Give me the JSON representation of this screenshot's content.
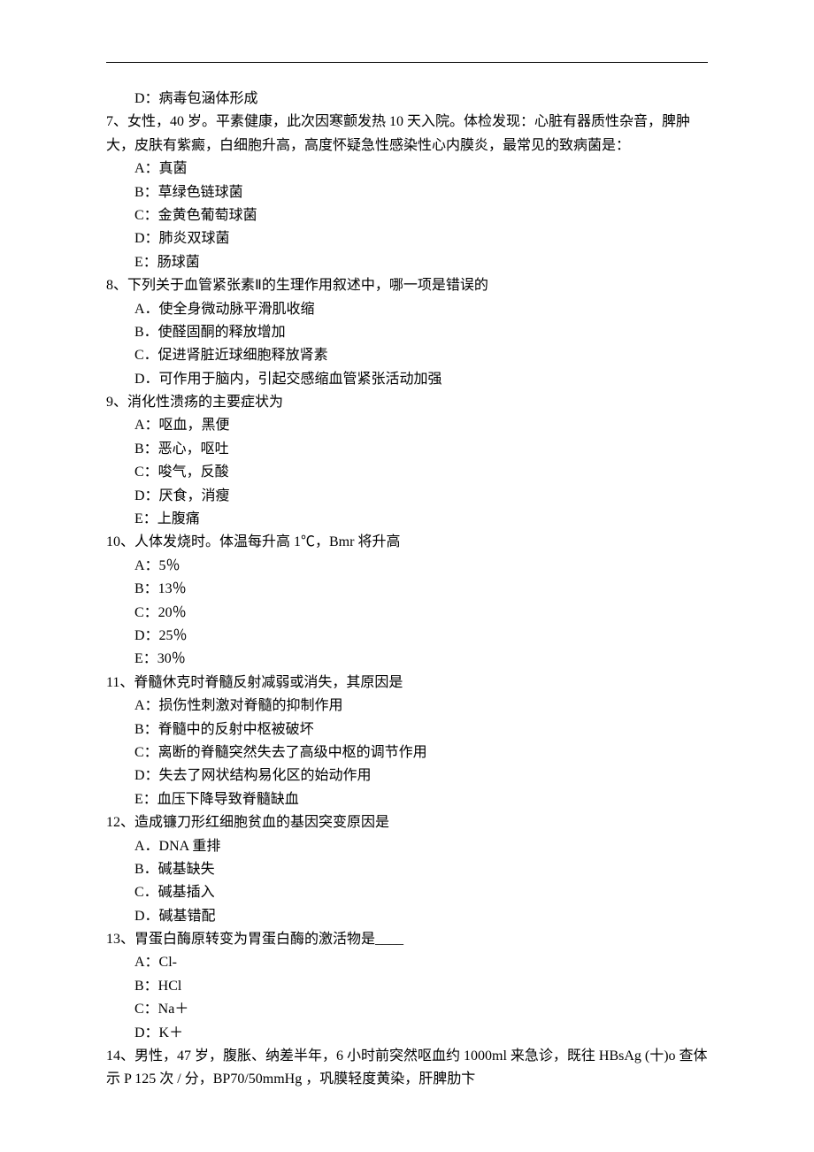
{
  "fragments": {
    "q6d": "　D：病毒包涵体形成"
  },
  "questions": {
    "q7": {
      "text": "7、女性，40 岁。平素健康，此次因寒颤发热 10 天入院。体检发现：心脏有器质性杂音，脾肿大，皮肤有紫癜，白细胞升高，高度怀疑急性感染性心内膜炎，最常见的致病菌是：",
      "options": {
        "a": "　A：真菌",
        "b": "　B：草绿色链球菌",
        "c": "　C：金黄色葡萄球菌",
        "d": "　D：肺炎双球菌",
        "e": "　E：肠球菌"
      }
    },
    "q8": {
      "text": "8、下列关于血管紧张素Ⅱ的生理作用叙述中，哪一项是错误的",
      "options": {
        "a": "　A．使全身微动脉平滑肌收缩",
        "b": "　B．使醛固酮的释放增加",
        "c": "　C．促进肾脏近球细胞释放肾素",
        "d": "　D．可作用于脑内，引起交感缩血管紧张活动加强"
      }
    },
    "q9": {
      "text": "9、消化性溃疡的主要症状为",
      "options": {
        "a": "　A：呕血，黑便",
        "b": "　B：恶心，呕吐",
        "c": "　C：唆气，反酸",
        "d": "　D：厌食，消瘦",
        "e": "　E：上腹痛"
      }
    },
    "q10": {
      "text": "10、人体发烧时。体温每升高 1℃，Bmr 将升高",
      "options": {
        "a": "　A：5％",
        "b": "　B：13％",
        "c": "　C：20％",
        "d": "　D：25％",
        "e": "　E：30％"
      }
    },
    "q11": {
      "text": "11、脊髓休克时脊髓反射减弱或消失，其原因是",
      "options": {
        "a": "　A：损伤性刺激对脊髓的抑制作用",
        "b": "　B：脊髓中的反射中枢被破坏",
        "c": "　C：离断的脊髓突然失去了高级中枢的调节作用",
        "d": "　D：失去了网状结构易化区的始动作用",
        "e": "　E：血压下降导致脊髓缺血"
      }
    },
    "q12": {
      "text": "12、造成镰刀形红细胞贫血的基因突变原因是",
      "options": {
        "a": "　A．DNA 重排",
        "b": "　B．碱基缺失",
        "c": "　C．碱基插入",
        "d": "　D．碱基错配"
      }
    },
    "q13": {
      "text": "13、胃蛋白酶原转变为胃蛋白酶的激活物是____",
      "options": {
        "a": "　A：Cl-",
        "b": "　B：HCl",
        "c": "　C：Na＋",
        "d": "　D：K＋"
      }
    },
    "q14": {
      "text": "14、男性，47 岁，腹胀、纳差半年，6 小时前突然呕血约 1000ml 来急诊，既往 HBsAg (十)o 查体示 P 125  次 / 分，BP70/50mmHg ，巩膜轻度黄染，肝脾肋卞"
    }
  }
}
